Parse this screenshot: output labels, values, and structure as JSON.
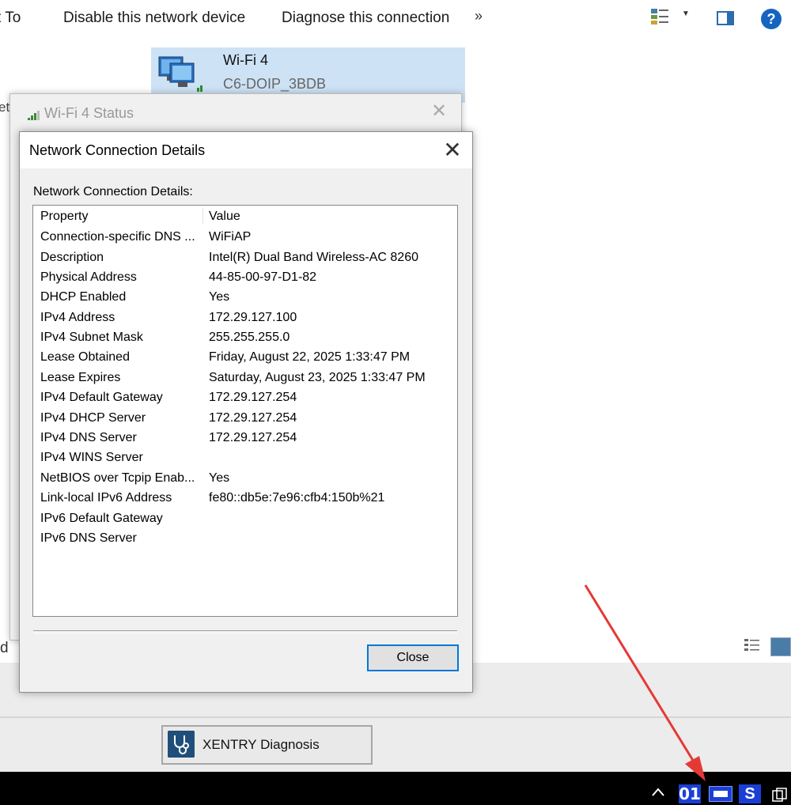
{
  "explorer": {
    "commands": [
      {
        "label": "t To"
      },
      {
        "label": "Disable this network device"
      },
      {
        "label": "Diagnose this connection"
      }
    ],
    "more": "»",
    "help": "?",
    "adapter": {
      "name": "Wi-Fi 4",
      "ssid": "C6-DOIP_3BDB"
    },
    "fragment_left": "et",
    "fragment_bottom": "d"
  },
  "status_window": {
    "title": "Wi-Fi 4 Status",
    "close": "✕"
  },
  "details_dialog": {
    "title": "Network Connection Details",
    "close": "✕",
    "list_label": "Network Connection Details:",
    "columns": {
      "property": "Property",
      "value": "Value"
    },
    "rows": [
      {
        "property": "Connection-specific DNS ...",
        "value": "WiFiAP"
      },
      {
        "property": "Description",
        "value": "Intel(R) Dual Band Wireless-AC 8260"
      },
      {
        "property": "Physical Address",
        "value": "44-85-00-97-D1-82"
      },
      {
        "property": "DHCP Enabled",
        "value": "Yes"
      },
      {
        "property": "IPv4 Address",
        "value": "172.29.127.100"
      },
      {
        "property": "IPv4 Subnet Mask",
        "value": "255.255.255.0"
      },
      {
        "property": "Lease Obtained",
        "value": "Friday, August 22, 2025 1:33:47 PM"
      },
      {
        "property": "Lease Expires",
        "value": "Saturday, August 23, 2025 1:33:47 PM"
      },
      {
        "property": "IPv4 Default Gateway",
        "value": "172.29.127.254"
      },
      {
        "property": "IPv4 DHCP Server",
        "value": "172.29.127.254"
      },
      {
        "property": "IPv4 DNS Server",
        "value": "172.29.127.254"
      },
      {
        "property": "IPv4 WINS Server",
        "value": ""
      },
      {
        "property": "NetBIOS over Tcpip Enab...",
        "value": "Yes"
      },
      {
        "property": "Link-local IPv6 Address",
        "value": "fe80::db5e:7e96:cfb4:150b%21"
      },
      {
        "property": "IPv6 Default Gateway",
        "value": ""
      },
      {
        "property": "IPv6 DNS Server",
        "value": ""
      }
    ],
    "close_button": "Close"
  },
  "xentry": {
    "label": "XENTRY Diagnosis"
  },
  "taskbar": {
    "tray_01": "01",
    "tray_s": "S"
  },
  "colors": {
    "accent": "#0078d7",
    "selection": "#cde2f5",
    "taskbar": "#000000",
    "annotation": "#e53935"
  }
}
